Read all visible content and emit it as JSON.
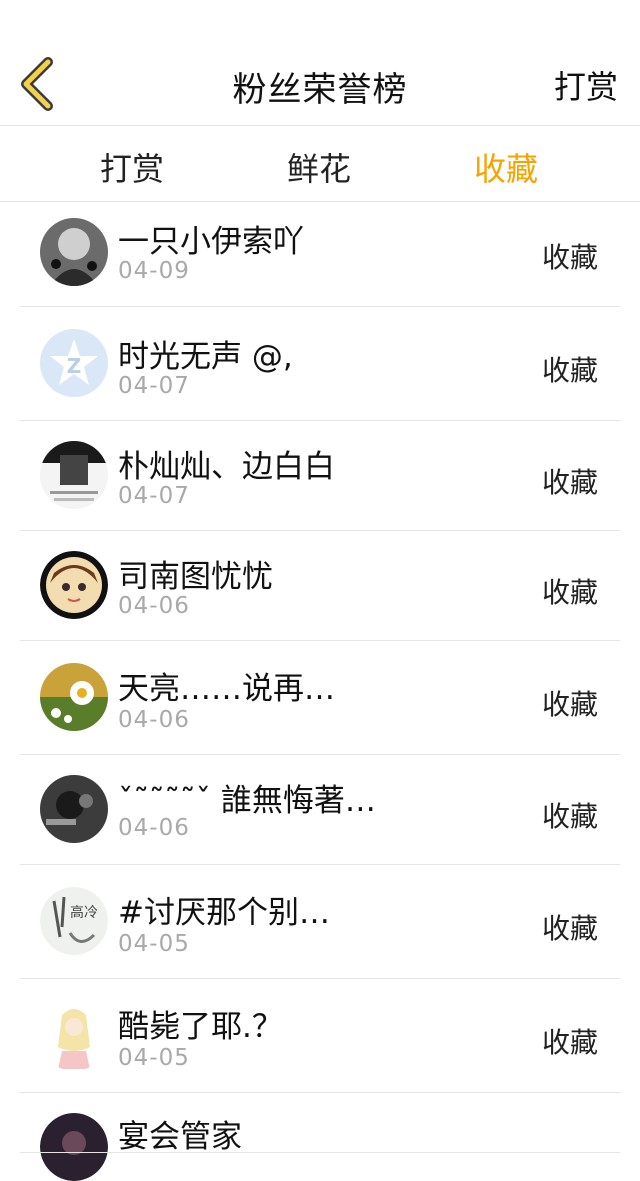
{
  "header": {
    "title": "粉丝荣誉榜",
    "right_label": "打赏"
  },
  "tabs": [
    {
      "label": "打赏",
      "active": false
    },
    {
      "label": "鲜花",
      "active": false
    },
    {
      "label": "收藏",
      "active": true
    }
  ],
  "colors": {
    "accent": "#f5a400",
    "divider": "#e5e5e5",
    "date": "#a9a9a9"
  },
  "list": [
    {
      "name": "一只小伊索吖",
      "date": "04-09",
      "action": "收藏",
      "avatar": "gray-sketch"
    },
    {
      "name": "时光无声 @,",
      "date": "04-07",
      "action": "收藏",
      "avatar": "qzone-star"
    },
    {
      "name": "朴灿灿、边白白",
      "date": "04-07",
      "action": "收藏",
      "avatar": "bw-poster"
    },
    {
      "name": "司南图忧忧",
      "date": "04-06",
      "action": "收藏",
      "avatar": "cartoon-girl"
    },
    {
      "name": "天亮……说再…",
      "date": "04-06",
      "action": "收藏",
      "avatar": "daisy-field"
    },
    {
      "name": "ˇ˜˜˜˜ˇ  誰無悔著…",
      "date": "04-06",
      "action": "收藏",
      "avatar": "dark-hand"
    },
    {
      "name": "#讨厌那个别…",
      "date": "04-05",
      "action": "收藏",
      "avatar": "calligraphy"
    },
    {
      "name": "酷毙了耶.？",
      "date": "04-05",
      "action": "收藏",
      "avatar": "blonde-girl"
    },
    {
      "name": "宴会管家",
      "date": "",
      "action": "",
      "avatar": "partial"
    }
  ]
}
